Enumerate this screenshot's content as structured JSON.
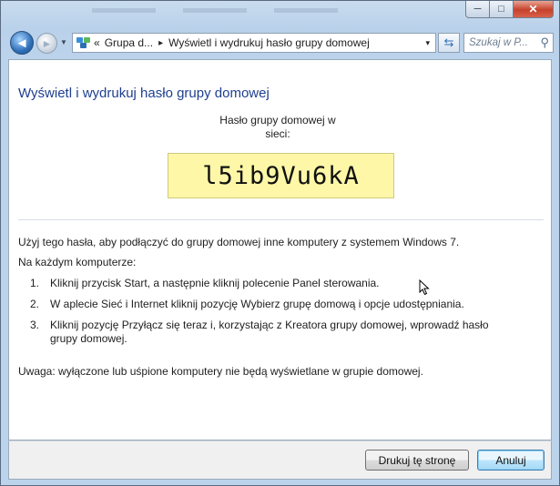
{
  "window": {
    "caption_buttons": {
      "minimize": "─",
      "maximize": "□",
      "close": "✕"
    }
  },
  "navbar": {
    "back_icon": "arrow-left-icon",
    "forward_icon": "arrow-right-icon",
    "breadcrumb": {
      "overflow": "«",
      "items": [
        "Grupa d...",
        "Wyświetl i wydrukuj hasło grupy domowej"
      ],
      "separator": "▸",
      "dropdown": "▾"
    },
    "refresh_icon": "⇆",
    "search": {
      "placeholder": "Szukaj w P...",
      "icon": "⚲"
    }
  },
  "main": {
    "title": "Wyświetl i wydrukuj hasło grupy domowej",
    "password_label": "Hasło grupy domowej w sieci:",
    "password": "l5ib9Vu6kA",
    "intro": "Użyj tego hasła, aby podłączyć do grupy domowej inne komputery z systemem Windows 7.",
    "on_each": "Na każdym komputerze:",
    "steps": [
      {
        "num": "1.",
        "text": "Kliknij przycisk Start, a następnie kliknij polecenie Panel sterowania."
      },
      {
        "num": "2.",
        "text": "W aplecie Sieć i Internet kliknij pozycję Wybierz grupę domową i opcje udostępniania."
      },
      {
        "num": "3.",
        "text": "Kliknij pozycję Przyłącz się teraz i, korzystając z Kreatora grupy domowej, wprowadź hasło grupy domowej."
      }
    ],
    "note": "Uwaga: wyłączone lub uśpione komputery nie będą wyświetlane w grupie domowej."
  },
  "footer": {
    "print_label": "Drukuj tę stronę",
    "cancel_label": "Anuluj"
  },
  "colors": {
    "title": "#1e3f8f",
    "password_bg": "#fdf7a7"
  }
}
